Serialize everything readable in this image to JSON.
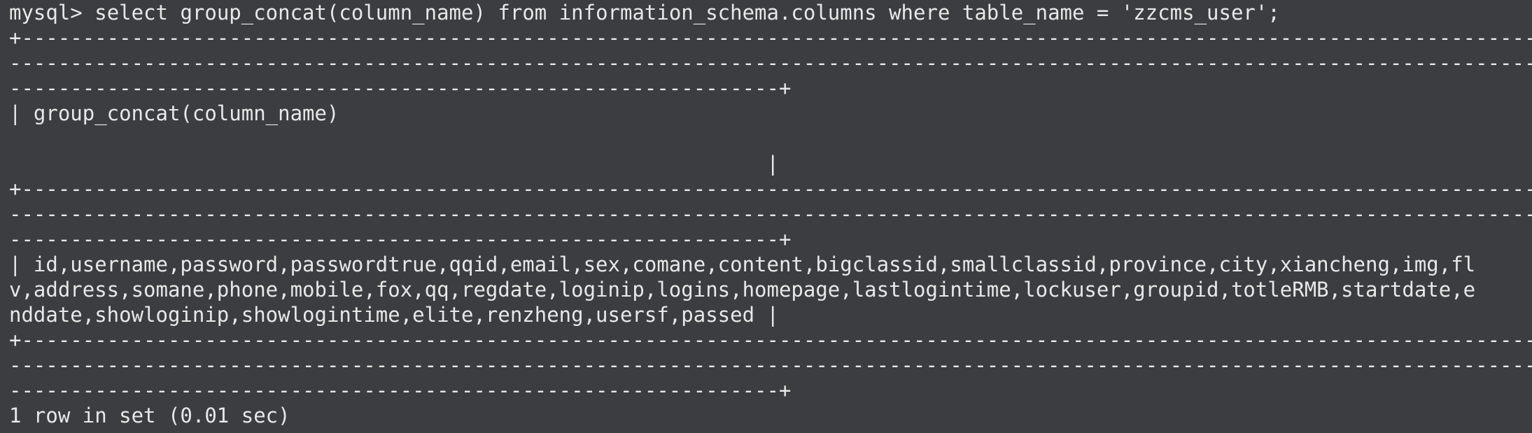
{
  "terminal": {
    "prompt": "mysql>",
    "command": "select group_concat(column_name) from information_schema.columns where table_name = 'zzcms_user';",
    "border_line_1": "+-----------------------------------------------------------------------------------------------------------------------------------",
    "border_line_2": "-----------------------------------------------------------------------------------------------------------------------------------",
    "border_line_3": "---------------------------------------------------------------+",
    "header_line": "| group_concat(column_name)",
    "header_close": "                                                              |",
    "row_line_1": "| id,username,password,passwordtrue,qqid,email,sex,comane,content,bigclassid,smallclassid,province,city,xiancheng,img,fl",
    "row_line_2": "v,address,somane,phone,mobile,fox,qq,regdate,loginip,logins,homepage,lastlogintime,lockuser,groupid,totleRMB,startdate,e",
    "row_line_3": "nddate,showloginip,showlogintime,elite,renzheng,usersf,passed |",
    "summary": "1 row in set (0.01 sec)"
  }
}
